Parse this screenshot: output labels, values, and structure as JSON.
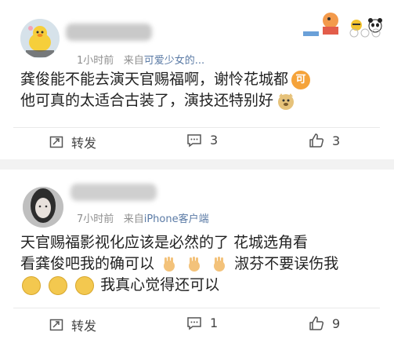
{
  "post1": {
    "time": "1小时前",
    "from_prefix": "来自",
    "source": "可爱少女的...",
    "lines": [
      "龚俊能不能去演天官赐福啊，谢怜花城都",
      "他可真的太适合古装了，演技还特别好"
    ],
    "actions": {
      "repost": "转发",
      "comments": "3",
      "likes": "3"
    }
  },
  "post2": {
    "time": "7小时前",
    "from_prefix": "来自",
    "source": "iPhone客户端",
    "lines": [
      "天官赐福影视化应该是必然的了 花城选角看",
      "看龚俊吧我的确可以",
      "淑芬不要误伤我",
      "我真心觉得还可以"
    ],
    "actions": {
      "repost": "转发",
      "comments": "1",
      "likes": "9"
    }
  },
  "icons": {
    "repost": "repost-icon",
    "comment": "comment-icon",
    "like": "like-icon"
  }
}
